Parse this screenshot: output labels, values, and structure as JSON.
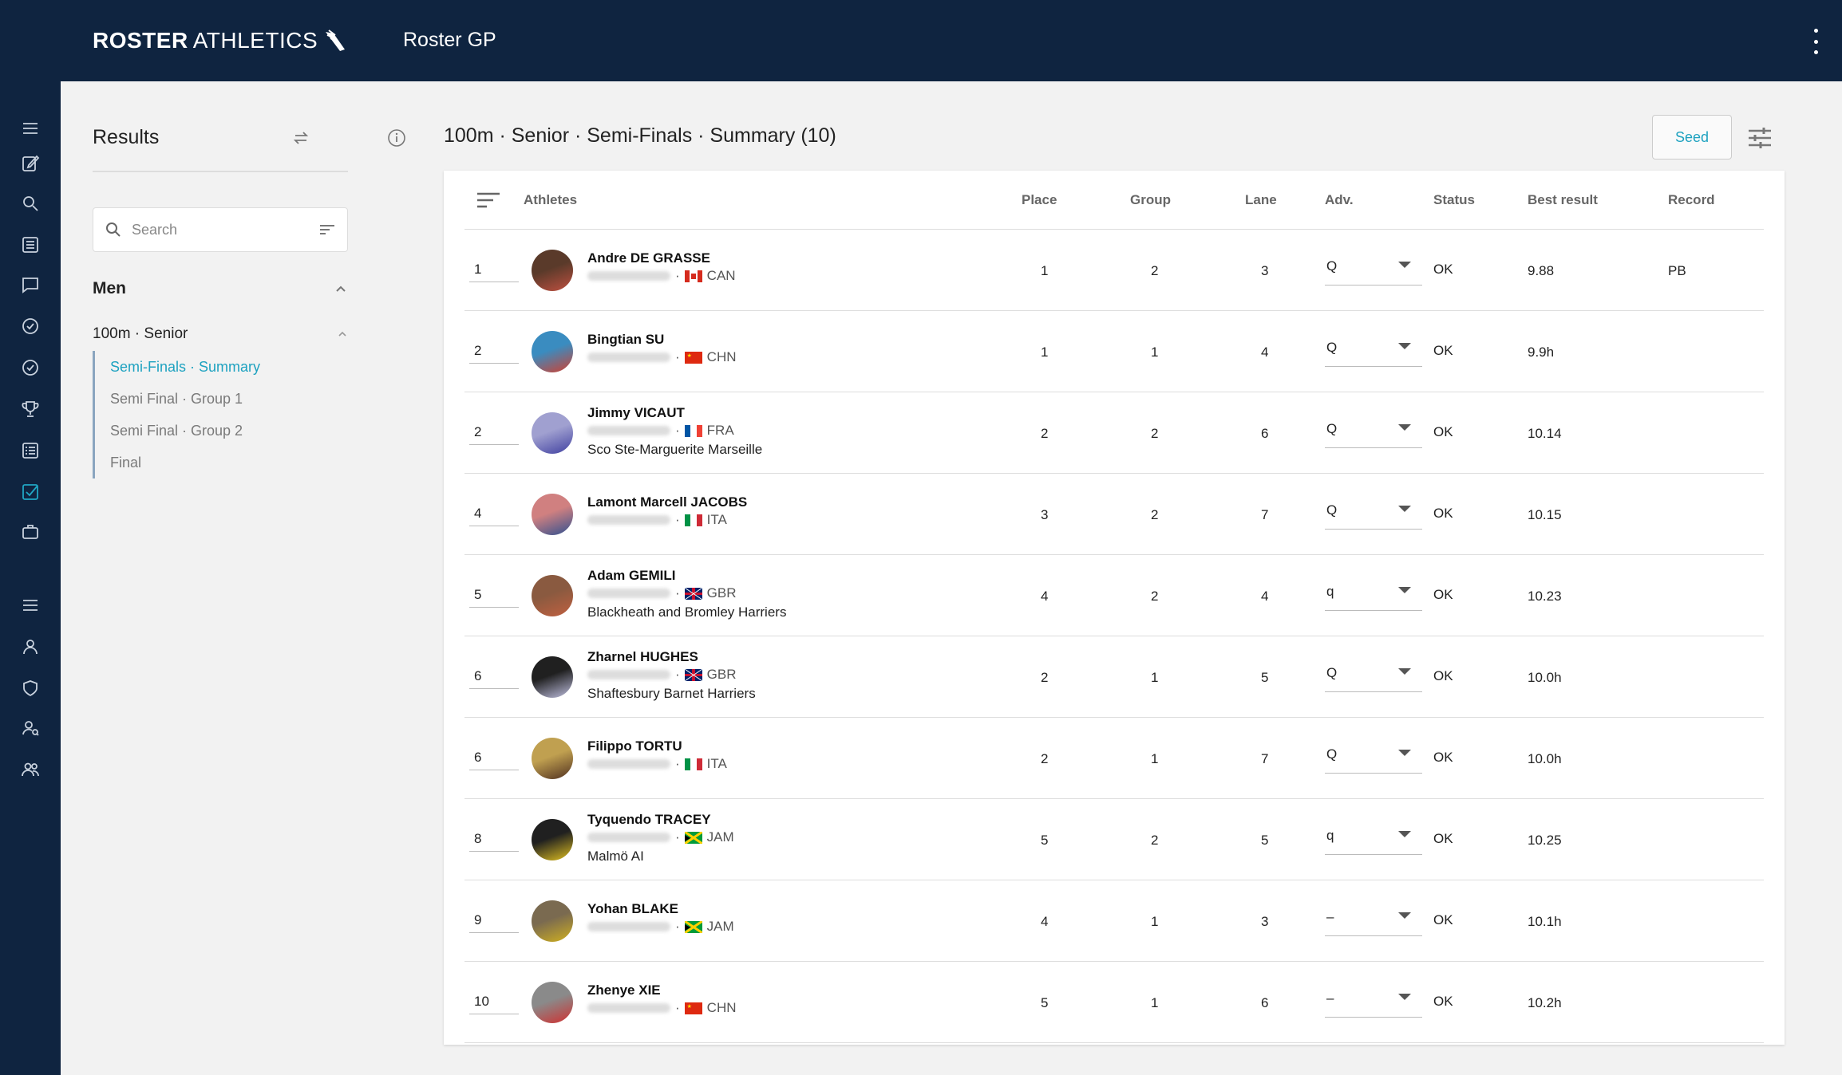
{
  "brand": {
    "bold": "ROSTER",
    "light": "ATHLETICS",
    "app_name": "Roster GP"
  },
  "colors": {
    "navy": "#0f2440",
    "accent": "#1ea2c0"
  },
  "rail_icons": [
    "menu-icon",
    "edit-icon",
    "search-icon",
    "list-icon",
    "chat-icon",
    "check-circle-icon",
    "check-circle-icon",
    "trophy-icon",
    "list-box-icon",
    "checkbox-icon",
    "briefcase-icon",
    "menu-icon",
    "person-icon",
    "shield-icon",
    "person-search-icon",
    "group-icon"
  ],
  "side": {
    "title": "Results",
    "search_placeholder": "Search",
    "group": "Men",
    "event": "100m · Senior",
    "rounds": [
      {
        "label": "Semi-Finals · Summary",
        "active": true
      },
      {
        "label": "Semi Final · Group 1",
        "active": false
      },
      {
        "label": "Semi Final · Group 2",
        "active": false
      },
      {
        "label": "Final",
        "active": false
      }
    ]
  },
  "main": {
    "title": "100m · Senior · Semi-Finals · Summary (10)",
    "seed_label": "Seed"
  },
  "table": {
    "headers": {
      "athletes": "Athletes",
      "place": "Place",
      "group": "Group",
      "lane": "Lane",
      "adv": "Adv.",
      "status": "Status",
      "best": "Best result",
      "record": "Record"
    },
    "rows": [
      {
        "rank": "1",
        "name": "Andre DE GRASSE",
        "country": "CAN",
        "club": "",
        "place": "1",
        "group": "2",
        "lane": "3",
        "adv": "Q",
        "status": "OK",
        "best": "9.88",
        "record": "PB"
      },
      {
        "rank": "2",
        "name": "Bingtian SU",
        "country": "CHN",
        "club": "",
        "place": "1",
        "group": "1",
        "lane": "4",
        "adv": "Q",
        "status": "OK",
        "best": "9.9h",
        "record": ""
      },
      {
        "rank": "2",
        "name": "Jimmy VICAUT",
        "country": "FRA",
        "club": "Sco Ste-Marguerite Marseille",
        "place": "2",
        "group": "2",
        "lane": "6",
        "adv": "Q",
        "status": "OK",
        "best": "10.14",
        "record": ""
      },
      {
        "rank": "4",
        "name": "Lamont Marcell JACOBS",
        "country": "ITA",
        "club": "",
        "place": "3",
        "group": "2",
        "lane": "7",
        "adv": "Q",
        "status": "OK",
        "best": "10.15",
        "record": ""
      },
      {
        "rank": "5",
        "name": "Adam GEMILI",
        "country": "GBR",
        "club": "Blackheath and Bromley Harriers",
        "place": "4",
        "group": "2",
        "lane": "4",
        "adv": "q",
        "status": "OK",
        "best": "10.23",
        "record": ""
      },
      {
        "rank": "6",
        "name": "Zharnel HUGHES",
        "country": "GBR",
        "club": "Shaftesbury Barnet Harriers",
        "place": "2",
        "group": "1",
        "lane": "5",
        "adv": "Q",
        "status": "OK",
        "best": "10.0h",
        "record": ""
      },
      {
        "rank": "6",
        "name": "Filippo TORTU",
        "country": "ITA",
        "club": "",
        "place": "2",
        "group": "1",
        "lane": "7",
        "adv": "Q",
        "status": "OK",
        "best": "10.0h",
        "record": ""
      },
      {
        "rank": "8",
        "name": "Tyquendo TRACEY",
        "country": "JAM",
        "club": "Malmö AI",
        "place": "5",
        "group": "2",
        "lane": "5",
        "adv": "q",
        "status": "OK",
        "best": "10.25",
        "record": ""
      },
      {
        "rank": "9",
        "name": "Yohan BLAKE",
        "country": "JAM",
        "club": "",
        "place": "4",
        "group": "1",
        "lane": "3",
        "adv": "–",
        "status": "OK",
        "best": "10.1h",
        "record": ""
      },
      {
        "rank": "10",
        "name": "Zhenye XIE",
        "country": "CHN",
        "club": "",
        "place": "5",
        "group": "1",
        "lane": "6",
        "adv": "–",
        "status": "OK",
        "best": "10.2h",
        "record": ""
      }
    ]
  }
}
